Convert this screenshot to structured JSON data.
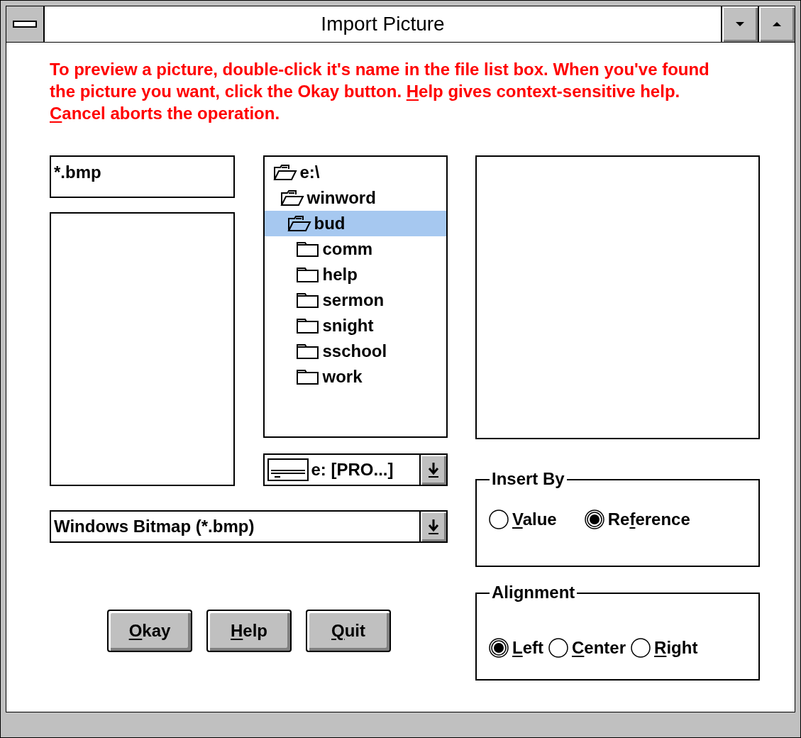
{
  "window": {
    "title": "Import Picture"
  },
  "instructions": [
    {
      "text": "To preview a picture, double-click it's name in the file list box. When you've found the picture you want, click the Okay button. ",
      "underline": false
    },
    {
      "text": "H",
      "underline": true
    },
    {
      "text": "elp gives context-sensitive help. ",
      "underline": false
    },
    {
      "text": "C",
      "underline": true
    },
    {
      "text": "ancel aborts the operation.",
      "underline": false
    }
  ],
  "filename_field": {
    "value": "*.bmp"
  },
  "directory_tree": [
    {
      "name": "e:\\",
      "expanded": true,
      "selected": false,
      "children": [
        {
          "name": "winword",
          "expanded": true,
          "selected": false,
          "children": [
            {
              "name": "bud",
              "expanded": true,
              "selected": true,
              "children": [
                {
                  "name": "comm",
                  "expanded": false,
                  "selected": false
                },
                {
                  "name": "help",
                  "expanded": false,
                  "selected": false
                },
                {
                  "name": "sermon",
                  "expanded": false,
                  "selected": false
                },
                {
                  "name": "snight",
                  "expanded": false,
                  "selected": false
                },
                {
                  "name": "sschool",
                  "expanded": false,
                  "selected": false
                },
                {
                  "name": "work",
                  "expanded": false,
                  "selected": false
                }
              ]
            }
          ]
        }
      ]
    }
  ],
  "drive_select": {
    "value": "e: [PRO...]"
  },
  "file_type_select": {
    "value": "Windows Bitmap (*.bmp)"
  },
  "insert_by": {
    "title": "Insert By",
    "options": [
      {
        "label": {
          "key": "V",
          "after": "alue"
        },
        "selected": false
      },
      {
        "label": {
          "before": "Re",
          "key": "f",
          "after": "erence"
        },
        "selected": true
      }
    ]
  },
  "alignment": {
    "title": "Alignment",
    "options": [
      {
        "label": {
          "key": "L",
          "after": "eft"
        },
        "selected": true
      },
      {
        "label": {
          "key": "C",
          "after": "enter"
        },
        "selected": false
      },
      {
        "label": {
          "key": "R",
          "after": "ight"
        },
        "selected": false
      }
    ]
  },
  "buttons": [
    {
      "key": "O",
      "after": "kay"
    },
    {
      "key": "H",
      "after": "elp"
    },
    {
      "key": "Q",
      "after": "uit"
    }
  ]
}
